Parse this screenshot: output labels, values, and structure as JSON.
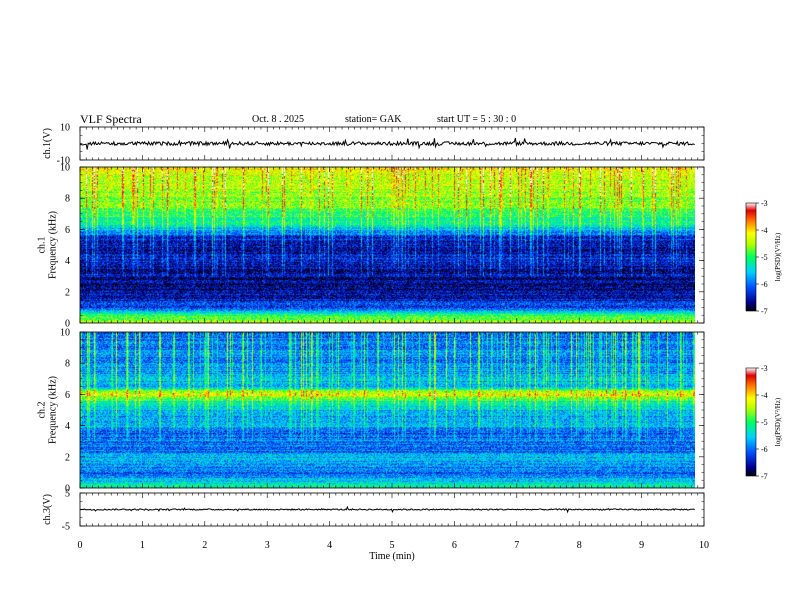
{
  "header": {
    "title": "VLF  Spectra",
    "date": "Oct. 8   . 2025",
    "station": "station= GAK",
    "start_ut": "start  UT  =    5  : 30 : 0"
  },
  "chart_data": [
    {
      "type": "line",
      "panel": "ch1-waveform",
      "ylabel": "ch.1(V)",
      "ylim": [
        -10,
        10
      ],
      "yticks": [
        "10",
        "-10"
      ],
      "xlim": [
        0,
        10
      ],
      "line_level": 0.0,
      "line_color": "#000000"
    },
    {
      "type": "heatmap",
      "panel": "ch1-spectrogram",
      "ylabel": "ch.1\nFrequency  (kHz)",
      "ylabel_lines": [
        "ch.1",
        "Frequency  (kHz)"
      ],
      "ylim": [
        0,
        10
      ],
      "yticks": [
        "0",
        "2",
        "4",
        "6",
        "8",
        "10"
      ],
      "xlim": [
        0,
        9.85
      ],
      "colorbar": {
        "label": "log(PSD)(V²/Hz)",
        "range": [
          -7,
          -3
        ],
        "ticks": [
          "-3",
          "-4",
          "-5",
          "-6",
          "-7"
        ]
      },
      "freq_profile_khz": [
        0,
        0.5,
        1,
        1.5,
        2,
        2.5,
        3,
        3.5,
        4,
        4.5,
        5,
        5.5,
        6,
        6.5,
        7,
        7.5,
        8,
        8.5,
        9,
        9.5,
        10
      ],
      "level_profile": [
        -4.3,
        -5.0,
        -6.1,
        -6.4,
        -6.6,
        -6.7,
        -6.6,
        -6.6,
        -6.4,
        -6.5,
        -6.6,
        -6.3,
        -5.6,
        -5.1,
        -4.9,
        -4.7,
        -4.6,
        -4.5,
        -4.4,
        -4.3,
        -4.2
      ]
    },
    {
      "type": "heatmap",
      "panel": "ch2-spectrogram",
      "ylabel_lines": [
        "ch.2",
        "Frequency  (kHz)"
      ],
      "ylim": [
        0,
        10
      ],
      "yticks": [
        "0",
        "2",
        "4",
        "6",
        "8",
        "10"
      ],
      "xlim": [
        0,
        9.85
      ],
      "colorbar": {
        "label": "log(PSD)(V²/Hz)",
        "range": [
          -7,
          -3
        ],
        "ticks": [
          "-3",
          "-4",
          "-5",
          "-6",
          "-7"
        ]
      },
      "freq_profile_khz": [
        0,
        0.5,
        1,
        1.5,
        2,
        2.5,
        3,
        3.5,
        4,
        4.5,
        5,
        5.5,
        6,
        6.5,
        7,
        7.5,
        8,
        8.5,
        9,
        9.5,
        10
      ],
      "level_profile": [
        -5.2,
        -5.6,
        -6.0,
        -5.8,
        -5.7,
        -6.1,
        -5.9,
        -6.2,
        -5.6,
        -5.9,
        -5.7,
        -5.3,
        -4.1,
        -5.6,
        -5.7,
        -5.8,
        -5.9,
        -5.9,
        -5.9,
        -6.0,
        -6.0
      ]
    },
    {
      "type": "line",
      "panel": "ch3-waveform",
      "ylabel": "ch.3(V)",
      "ylim": [
        -5,
        5
      ],
      "yticks": [
        "5",
        "-5"
      ],
      "xlim": [
        0,
        10
      ],
      "line_level": 0.0,
      "line_color": "#000000"
    }
  ],
  "x_axis": {
    "label": "Time  (min)",
    "ticks": [
      "0",
      "1",
      "2",
      "3",
      "4",
      "5",
      "6",
      "7",
      "8",
      "9",
      "10"
    ],
    "range": [
      0,
      10
    ]
  }
}
